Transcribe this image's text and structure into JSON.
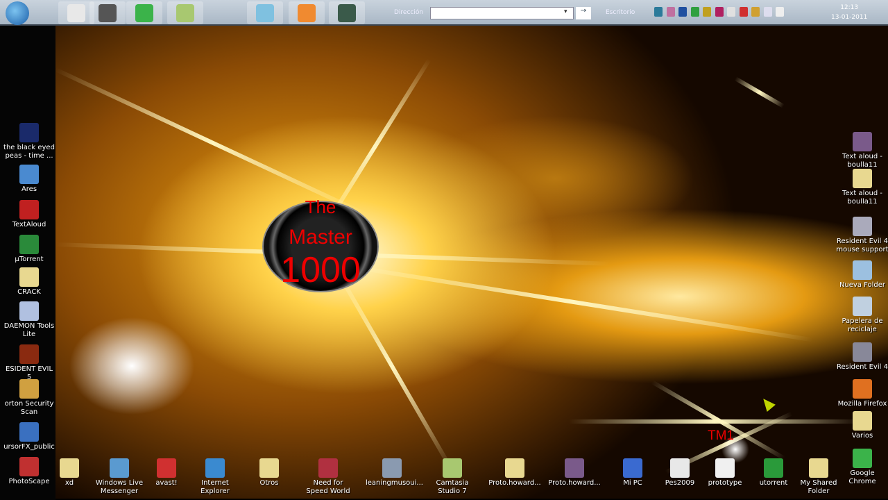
{
  "taskbar": {
    "apps": [
      {
        "name": "pes-app",
        "color": "#e8e8e8"
      },
      {
        "name": "photo-app",
        "color": "#555"
      },
      {
        "name": "chrome",
        "color": "#3bb34a"
      },
      {
        "name": "camtasia-app",
        "color": "#a8c870"
      },
      {
        "name": "notepad-app",
        "color": "#7fc1e0"
      },
      {
        "name": "media-player",
        "color": "#f08a30"
      },
      {
        "name": "recorder-app",
        "color": "#3a5a4a"
      }
    ],
    "address_label": "Dirección",
    "address_value": "",
    "go_label": "→",
    "toolbar_label": "Escritorio",
    "time": "12:13",
    "date": "13-01-2011",
    "tray_colors": [
      "#2b7a9a",
      "#c070a0",
      "#2050a0",
      "#30a040",
      "#c0a020",
      "#b02060",
      "#e0e0e0",
      "#d03030",
      "#d0a030",
      "#dde",
      "#eee"
    ]
  },
  "left_icons": [
    {
      "label": "the black eyed peas - time ...",
      "color": "#1a2a6a"
    },
    {
      "label": "Ares",
      "color": "#4a8ad0"
    },
    {
      "label": "TextAloud",
      "color": "#c02020"
    },
    {
      "label": "µTorrent",
      "color": "#2a8a3a"
    },
    {
      "label": "CRACK",
      "color": "#e8d890"
    },
    {
      "label": "DAEMON Tools Lite",
      "color": "#b0c0e0"
    },
    {
      "label": "ESIDENT EVIL 5",
      "color": "#8a2a10"
    },
    {
      "label": "orton Security Scan",
      "color": "#d0a040"
    },
    {
      "label": "ursorFX_public",
      "color": "#3a70c0"
    },
    {
      "label": "PhotoScape",
      "color": "#c03030"
    }
  ],
  "right_icons": [
    {
      "label": "Text aloud - boulla11",
      "color": "#7a5a8a"
    },
    {
      "label": "Text aloud - boulla11",
      "color": "#e8d890"
    },
    {
      "label": "Resident Evil 4 mouse support",
      "color": "#aab"
    },
    {
      "label": "Nueva Folder",
      "color": "#9cc0e0"
    },
    {
      "label": "Papelera de reciclaje",
      "color": "#c0d0e0"
    },
    {
      "label": "Resident Evil 4",
      "color": "#889"
    },
    {
      "label": "Mozilla Firefox",
      "color": "#e07020"
    },
    {
      "label": "Varios",
      "color": "#e8d890"
    },
    {
      "label": "Google Chrome",
      "color": "#3bb34a"
    }
  ],
  "bottom_icons": [
    {
      "label": "xd",
      "color": "#e8d890"
    },
    {
      "label": "Windows Live Messenger",
      "color": "#5a9ad0"
    },
    {
      "label": "avast!",
      "color": "#d03030"
    },
    {
      "label": "Internet Explorer",
      "color": "#3a8ad0"
    },
    {
      "label": "Otros",
      "color": "#e8d890"
    },
    {
      "label": "Need for Speed World",
      "color": "#b03040"
    },
    {
      "label": "leaningmusoui...",
      "color": "#8a9ab0"
    },
    {
      "label": "Camtasia Studio 7",
      "color": "#a8c870"
    },
    {
      "label": "Proto.howard...",
      "color": "#e8d890"
    },
    {
      "label": "Proto.howard...",
      "color": "#7a5a8a"
    },
    {
      "label": "Mi PC",
      "color": "#3a6ad0"
    },
    {
      "label": "Pes2009",
      "color": "#e8e8e8"
    },
    {
      "label": "prototype",
      "color": "#f0f0f0"
    },
    {
      "label": "utorrent",
      "color": "#2a9a3a"
    },
    {
      "label": "My Shared Folder",
      "color": "#e8d890"
    }
  ],
  "wallpaper": {
    "logo_line1": "The",
    "logo_line2": "Master",
    "logo_line3": "1000",
    "signature": "TM1"
  }
}
